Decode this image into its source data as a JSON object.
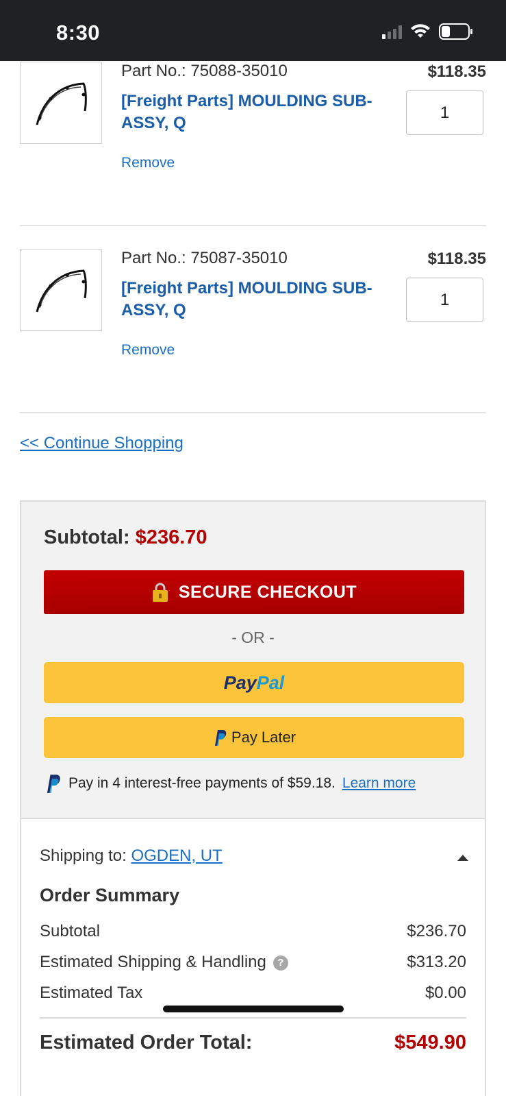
{
  "status_bar": {
    "time": "8:30"
  },
  "cart": {
    "items": [
      {
        "part_no": "Part No.: 75088-35010",
        "title": "[Freight Parts] MOULDING SUB-ASSY, Q",
        "price": "$118.35",
        "quantity": "1",
        "remove_label": "Remove",
        "thumbnail_icon": "moulding-part-icon"
      },
      {
        "part_no": "Part No.: 75087-35010",
        "title": "[Freight Parts] MOULDING SUB-ASSY, Q",
        "price": "$118.35",
        "quantity": "1",
        "remove_label": "Remove",
        "thumbnail_icon": "moulding-part-icon"
      }
    ],
    "continue_shopping": "<< Continue Shopping"
  },
  "checkout": {
    "subtotal_label": "Subtotal:",
    "subtotal_value": "$236.70",
    "secure_checkout_label": "SECURE CHECKOUT",
    "or_label": "- OR -",
    "paypal_label_a": "Pay",
    "paypal_label_b": "Pal",
    "pay_later_label": "Pay Later",
    "pay_in_4_text": "Pay in 4 interest-free payments of $59.18.",
    "learn_more": "Learn more"
  },
  "order_summary": {
    "shipping_to_label": "Shipping to:",
    "shipping_city": "OGDEN, UT",
    "title": "Order Summary",
    "rows": [
      {
        "label": "Subtotal",
        "value": "$236.70"
      },
      {
        "label": "Estimated Shipping & Handling",
        "value": "$313.20"
      },
      {
        "label": "Estimated Tax",
        "value": "$0.00"
      }
    ],
    "total_label": "Estimated Order Total:",
    "total_value": "$549.90"
  },
  "colors": {
    "accent_red": "#b30000",
    "link_blue": "#1a6fc4",
    "title_blue": "#1a5da8",
    "paypal_yellow": "#fcc43b"
  }
}
